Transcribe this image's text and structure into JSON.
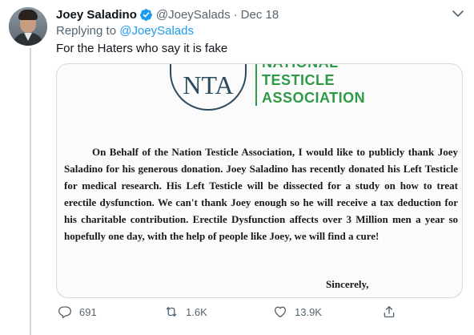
{
  "tweet": {
    "author_name": "Joey Saladino",
    "handle": "@JoeySalads",
    "separator": "·",
    "date": "Dec 18",
    "replying_prefix": "Replying to",
    "replying_to": "@JoeySalads",
    "text": "For the Haters who say it is fake"
  },
  "letter": {
    "org_line1": "NATIONAL",
    "org_line2": "TESTICLE",
    "org_line3": "ASSOCIATION",
    "logo_abbrev": "NTA",
    "body": "On Behalf of the Nation Testicle Association, I would like to publicly thank Joey Saladino for his generous donation. Joey Saladino has recently donated his Left Testicle for medical research. His Left Testicle will be dissected for a study on how to treat erectile dysfunction. We can't thank Joey enough so he will receive a tax deduction for his charitable contribution. Erectile Dysfunction affects over 3 Million men a year so hopefully one day, with the help of people like Joey, we will find a cure!",
    "closing": "Sincerely,"
  },
  "actions": {
    "replies": "691",
    "retweets": "1.6K",
    "likes": "13.9K"
  },
  "icons": {
    "verified": "verified-badge-icon",
    "more": "more-icon",
    "reply": "reply-icon",
    "retweet": "retweet-icon",
    "like": "heart-icon",
    "share": "share-icon"
  },
  "colors": {
    "accent": "#1d9bf0",
    "secondary_text": "#536471",
    "logo_green": "#2e9a47",
    "logo_navy": "#2b4b5f"
  }
}
